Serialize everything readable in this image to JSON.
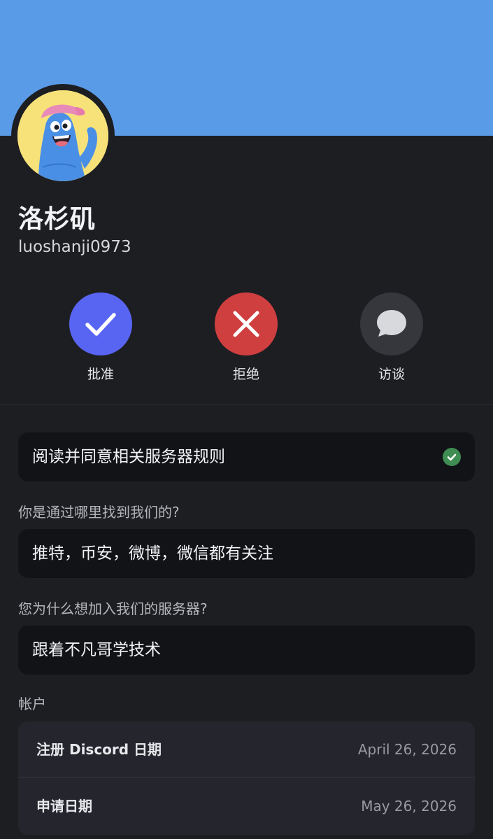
{
  "profile": {
    "display_name": "洛杉矶",
    "username": "luoshanji0973",
    "banner_color": "#5a9be8",
    "avatar_bg": "#f7e27a"
  },
  "actions": [
    {
      "label": "批准",
      "icon": "checkmark-icon",
      "color": "#5865f2"
    },
    {
      "label": "拒绝",
      "icon": "close-icon",
      "color": "#d03f3f"
    },
    {
      "label": "访谈",
      "icon": "chat-bubble-icon",
      "color": "#36373d"
    }
  ],
  "rules": {
    "text": "阅读并同意相关服务器规则",
    "status_icon": "check-circle-icon",
    "status_color": "#3f8d52"
  },
  "questions": [
    {
      "question": "你是通过哪里找到我们的?",
      "answer": "推特，币安，微博，微信都有关注"
    },
    {
      "question": "您为什么想加入我们的服务器?",
      "answer": "跟着不凡哥学技术"
    }
  ],
  "account": {
    "heading": "帐户",
    "rows": [
      {
        "label": "注册 Discord 日期",
        "value": "April 26, 2026"
      },
      {
        "label": "申请日期",
        "value": "May 26, 2026"
      }
    ]
  }
}
